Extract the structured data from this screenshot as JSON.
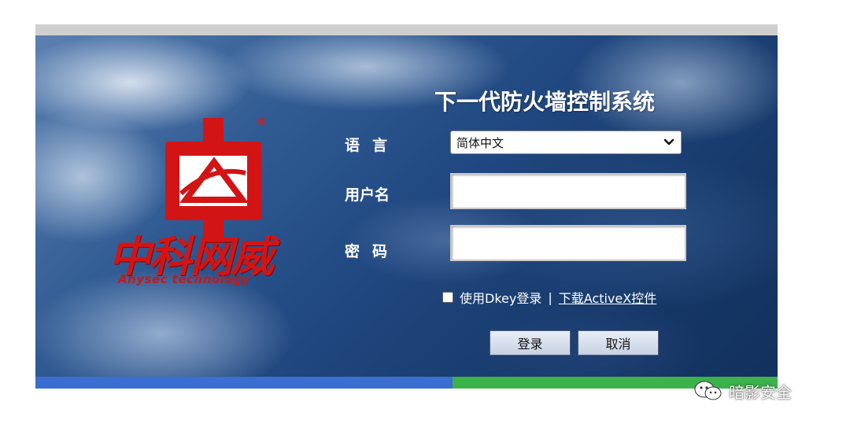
{
  "title": "下一代防火墙控制系统",
  "logo": {
    "registered": "®",
    "name_cn": "中科网威",
    "name_en": "Anysec technology"
  },
  "form": {
    "language_label": "语言",
    "language_selected": "简体中文",
    "username_label": "用户名",
    "username_value": "",
    "password_label": "密码",
    "password_value": "",
    "dkey_label": "使用Dkey登录",
    "separator": "|",
    "download_link": "下载ActiveX控件",
    "login_button": "登录",
    "cancel_button": "取消"
  },
  "watermark": {
    "text": "暗影安全",
    "icon": "wechat-icon"
  },
  "colors": {
    "logo_red": "#d31414",
    "bottom_blue": "#3a6ed0",
    "bottom_green": "#3bb34a",
    "top_bar": "#cfcfcf"
  }
}
